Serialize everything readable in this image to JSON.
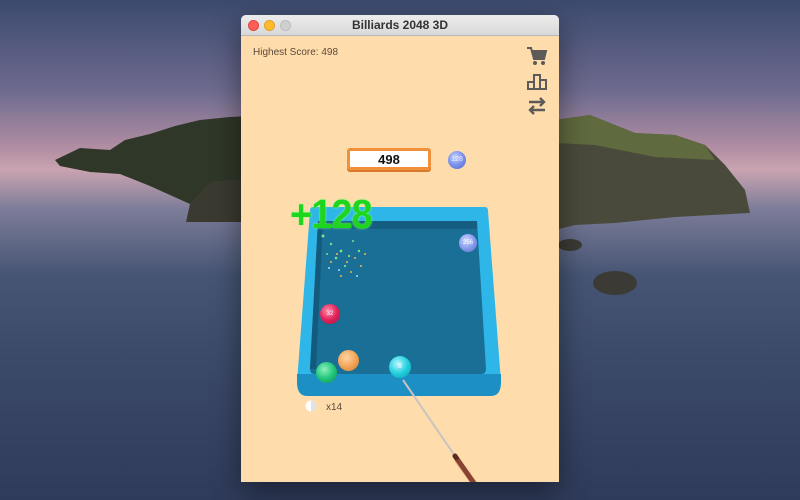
{
  "window": {
    "title": "Billiards 2048 3D"
  },
  "hud": {
    "highest_score": "Highest Score: 498",
    "current_score": "498",
    "next_ball_number": "128",
    "combo_popup": "+128",
    "shots_label": "x14"
  },
  "icons": [
    "cart-icon",
    "leaderboard-icon",
    "swap-icon"
  ],
  "balls": [
    {
      "name": "ball-top-right",
      "label": "256",
      "color": "#7f95ee"
    },
    {
      "name": "ball-pink",
      "label": "32",
      "color": "#e2235a"
    },
    {
      "name": "ball-orange",
      "label": "",
      "color": "#f2a65a"
    },
    {
      "name": "ball-green",
      "label": "",
      "color": "#21c77a"
    },
    {
      "name": "cue-ball-cyan",
      "label": "8",
      "color": "#23d0df"
    }
  ],
  "colors": {
    "background": "#ffdcab",
    "table_rim": "#2eb6e8",
    "table_felt": "#196f96",
    "score_border": "#f0913a",
    "popup_text": "#1fd61f"
  }
}
